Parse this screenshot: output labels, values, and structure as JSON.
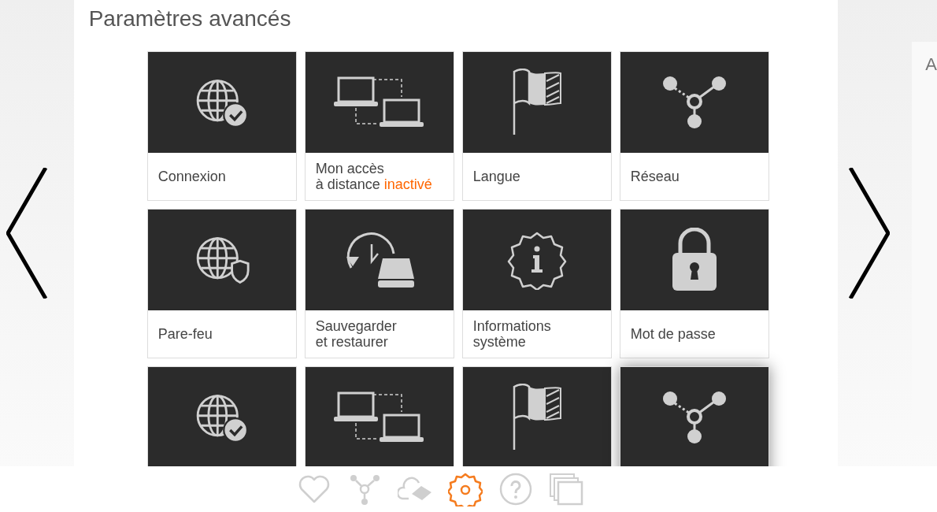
{
  "title": "Paramètres avancés",
  "tiles": [
    {
      "kind": "globe-check",
      "lines": [
        "Connexion"
      ],
      "hovered": false
    },
    {
      "kind": "laptops",
      "lines": [
        "Mon accès",
        "à distance"
      ],
      "status": "inactivé",
      "hovered": false
    },
    {
      "kind": "flag",
      "lines": [
        "Langue"
      ],
      "hovered": false
    },
    {
      "kind": "network",
      "lines": [
        "Réseau"
      ],
      "hovered": false
    },
    {
      "kind": "globe-shield",
      "lines": [
        "Pare-feu"
      ],
      "hovered": false
    },
    {
      "kind": "backup",
      "lines": [
        "Sauvegarder",
        "et restaurer"
      ],
      "hovered": false
    },
    {
      "kind": "info-gear",
      "lines": [
        "Informations",
        "système"
      ],
      "hovered": false
    },
    {
      "kind": "lock",
      "lines": [
        "Mot de passe"
      ],
      "hovered": false
    },
    {
      "kind": "globe-check",
      "hovered": false
    },
    {
      "kind": "laptops",
      "hovered": false
    },
    {
      "kind": "flag",
      "hovered": false
    },
    {
      "kind": "network",
      "hovered": true
    }
  ],
  "next_panel": {
    "title": "A"
  },
  "nav": [
    {
      "kind": "heart",
      "selected": false
    },
    {
      "kind": "network",
      "selected": false
    },
    {
      "kind": "cloud",
      "selected": false
    },
    {
      "kind": "gear",
      "selected": true
    },
    {
      "kind": "help",
      "selected": false
    },
    {
      "kind": "windows",
      "selected": false
    }
  ]
}
